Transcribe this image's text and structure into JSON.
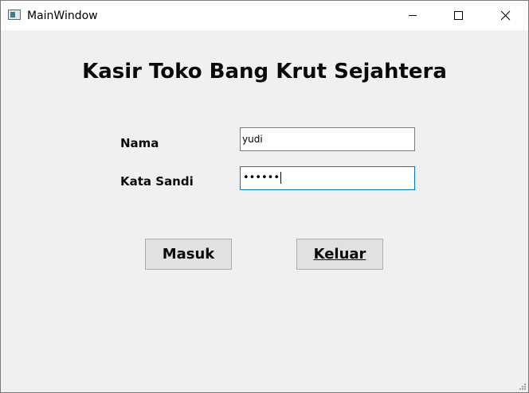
{
  "window": {
    "title": "MainWindow",
    "icon": "app-window-icon",
    "controls": {
      "minimize": "minimize-icon",
      "maximize": "maximize-icon",
      "close": "close-icon"
    }
  },
  "form": {
    "heading": "Kasir Toko Bang Krut Sejahtera",
    "name_label": "Nama",
    "name_value": "yudi",
    "password_label": "Kata Sandi",
    "password_mask": "••••••"
  },
  "buttons": {
    "login_label": "Masuk",
    "exit_label": "Keluar"
  },
  "colors": {
    "background": "#f0f0f0",
    "focus_border": "#0078d7",
    "button_face": "#e1e1e1"
  }
}
